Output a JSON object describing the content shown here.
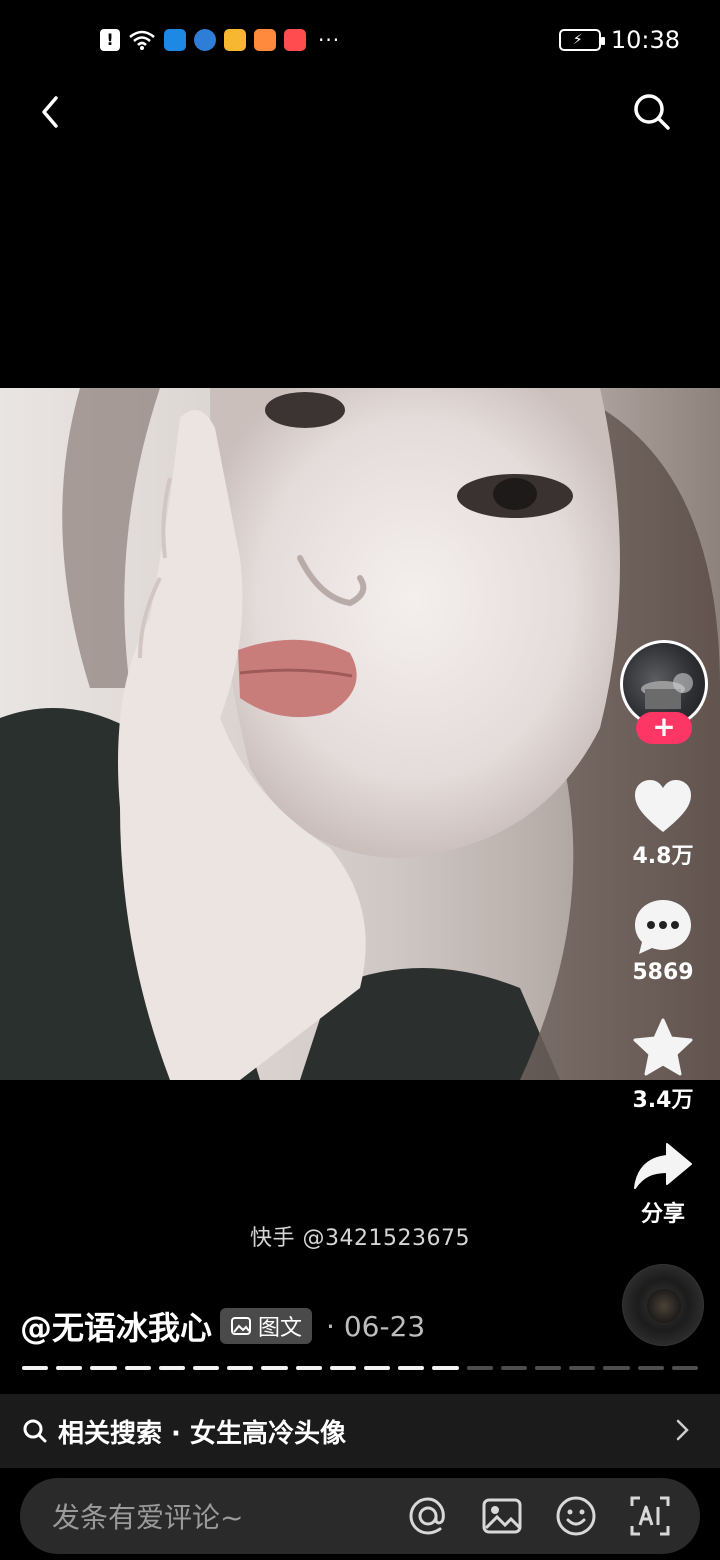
{
  "status_bar": {
    "time": "10:38",
    "alert_glyph": "!",
    "more_glyph": "···",
    "icons": [
      "alert-icon",
      "wifi-icon",
      "weather-app-icon",
      "browser-app-icon",
      "pinduoduo-app-icon",
      "video-app-icon",
      "huawei-app-icon",
      "battery-icon"
    ],
    "app_colors": [
      "#1e88e5",
      "#2e7dd7",
      "#f7b731",
      "#ff8a3d",
      "#ff4d4f"
    ]
  },
  "nav": {
    "back_icon": "chevron-left-icon",
    "search_icon": "search-icon"
  },
  "actions": {
    "follow_glyph": "+",
    "like_count": "4.8万",
    "comment_count": "5869",
    "favorite_count": "3.4万",
    "share_label": "分享"
  },
  "watermark": "快手 @3421523675",
  "post": {
    "author": "@无语冰我心",
    "tag_label": "图文",
    "date_sep": "·",
    "date": "06-23",
    "progress": {
      "total": 20,
      "current": 13
    }
  },
  "related": {
    "label": "相关搜索 · 女生高冷头像"
  },
  "comment_input": {
    "placeholder": "发条有爱评论~"
  },
  "colors": {
    "accent": "#fe3666",
    "background": "#000000",
    "bar": "#1b1b1b"
  }
}
